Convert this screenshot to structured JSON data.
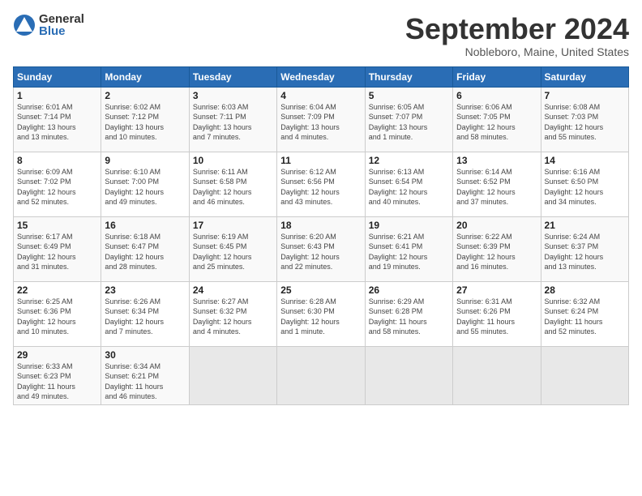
{
  "header": {
    "logo_general": "General",
    "logo_blue": "Blue",
    "month_title": "September 2024",
    "subtitle": "Nobleboro, Maine, United States"
  },
  "weekdays": [
    "Sunday",
    "Monday",
    "Tuesday",
    "Wednesday",
    "Thursday",
    "Friday",
    "Saturday"
  ],
  "weeks": [
    [
      {
        "day": "1",
        "info": "Sunrise: 6:01 AM\nSunset: 7:14 PM\nDaylight: 13 hours\nand 13 minutes."
      },
      {
        "day": "2",
        "info": "Sunrise: 6:02 AM\nSunset: 7:12 PM\nDaylight: 13 hours\nand 10 minutes."
      },
      {
        "day": "3",
        "info": "Sunrise: 6:03 AM\nSunset: 7:11 PM\nDaylight: 13 hours\nand 7 minutes."
      },
      {
        "day": "4",
        "info": "Sunrise: 6:04 AM\nSunset: 7:09 PM\nDaylight: 13 hours\nand 4 minutes."
      },
      {
        "day": "5",
        "info": "Sunrise: 6:05 AM\nSunset: 7:07 PM\nDaylight: 13 hours\nand 1 minute."
      },
      {
        "day": "6",
        "info": "Sunrise: 6:06 AM\nSunset: 7:05 PM\nDaylight: 12 hours\nand 58 minutes."
      },
      {
        "day": "7",
        "info": "Sunrise: 6:08 AM\nSunset: 7:03 PM\nDaylight: 12 hours\nand 55 minutes."
      }
    ],
    [
      {
        "day": "8",
        "info": "Sunrise: 6:09 AM\nSunset: 7:02 PM\nDaylight: 12 hours\nand 52 minutes."
      },
      {
        "day": "9",
        "info": "Sunrise: 6:10 AM\nSunset: 7:00 PM\nDaylight: 12 hours\nand 49 minutes."
      },
      {
        "day": "10",
        "info": "Sunrise: 6:11 AM\nSunset: 6:58 PM\nDaylight: 12 hours\nand 46 minutes."
      },
      {
        "day": "11",
        "info": "Sunrise: 6:12 AM\nSunset: 6:56 PM\nDaylight: 12 hours\nand 43 minutes."
      },
      {
        "day": "12",
        "info": "Sunrise: 6:13 AM\nSunset: 6:54 PM\nDaylight: 12 hours\nand 40 minutes."
      },
      {
        "day": "13",
        "info": "Sunrise: 6:14 AM\nSunset: 6:52 PM\nDaylight: 12 hours\nand 37 minutes."
      },
      {
        "day": "14",
        "info": "Sunrise: 6:16 AM\nSunset: 6:50 PM\nDaylight: 12 hours\nand 34 minutes."
      }
    ],
    [
      {
        "day": "15",
        "info": "Sunrise: 6:17 AM\nSunset: 6:49 PM\nDaylight: 12 hours\nand 31 minutes."
      },
      {
        "day": "16",
        "info": "Sunrise: 6:18 AM\nSunset: 6:47 PM\nDaylight: 12 hours\nand 28 minutes."
      },
      {
        "day": "17",
        "info": "Sunrise: 6:19 AM\nSunset: 6:45 PM\nDaylight: 12 hours\nand 25 minutes."
      },
      {
        "day": "18",
        "info": "Sunrise: 6:20 AM\nSunset: 6:43 PM\nDaylight: 12 hours\nand 22 minutes."
      },
      {
        "day": "19",
        "info": "Sunrise: 6:21 AM\nSunset: 6:41 PM\nDaylight: 12 hours\nand 19 minutes."
      },
      {
        "day": "20",
        "info": "Sunrise: 6:22 AM\nSunset: 6:39 PM\nDaylight: 12 hours\nand 16 minutes."
      },
      {
        "day": "21",
        "info": "Sunrise: 6:24 AM\nSunset: 6:37 PM\nDaylight: 12 hours\nand 13 minutes."
      }
    ],
    [
      {
        "day": "22",
        "info": "Sunrise: 6:25 AM\nSunset: 6:36 PM\nDaylight: 12 hours\nand 10 minutes."
      },
      {
        "day": "23",
        "info": "Sunrise: 6:26 AM\nSunset: 6:34 PM\nDaylight: 12 hours\nand 7 minutes."
      },
      {
        "day": "24",
        "info": "Sunrise: 6:27 AM\nSunset: 6:32 PM\nDaylight: 12 hours\nand 4 minutes."
      },
      {
        "day": "25",
        "info": "Sunrise: 6:28 AM\nSunset: 6:30 PM\nDaylight: 12 hours\nand 1 minute."
      },
      {
        "day": "26",
        "info": "Sunrise: 6:29 AM\nSunset: 6:28 PM\nDaylight: 11 hours\nand 58 minutes."
      },
      {
        "day": "27",
        "info": "Sunrise: 6:31 AM\nSunset: 6:26 PM\nDaylight: 11 hours\nand 55 minutes."
      },
      {
        "day": "28",
        "info": "Sunrise: 6:32 AM\nSunset: 6:24 PM\nDaylight: 11 hours\nand 52 minutes."
      }
    ],
    [
      {
        "day": "29",
        "info": "Sunrise: 6:33 AM\nSunset: 6:23 PM\nDaylight: 11 hours\nand 49 minutes."
      },
      {
        "day": "30",
        "info": "Sunrise: 6:34 AM\nSunset: 6:21 PM\nDaylight: 11 hours\nand 46 minutes."
      },
      {
        "day": "",
        "info": ""
      },
      {
        "day": "",
        "info": ""
      },
      {
        "day": "",
        "info": ""
      },
      {
        "day": "",
        "info": ""
      },
      {
        "day": "",
        "info": ""
      }
    ]
  ]
}
